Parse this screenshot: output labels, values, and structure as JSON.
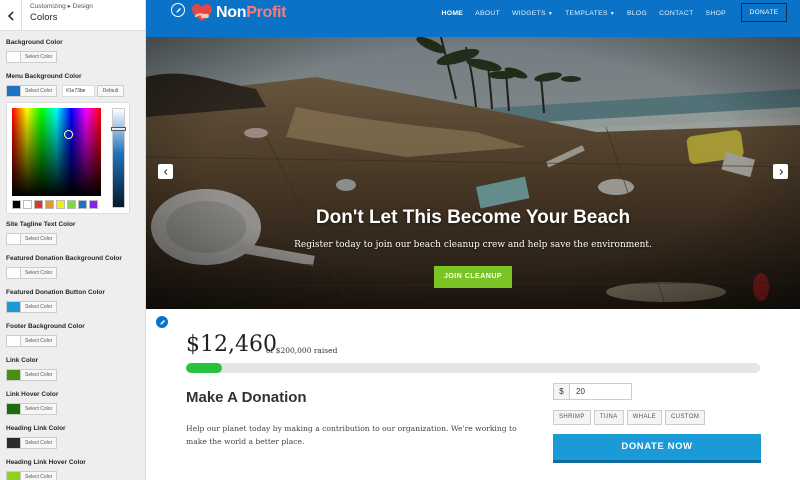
{
  "sidebar": {
    "breadcrumb": "Customizing ▸ Design",
    "title": "Colors",
    "fields": [
      {
        "label": "Background Color",
        "button": "Select Color",
        "color": "#ffffff"
      },
      {
        "label": "Menu Background Color",
        "button": "Select Color",
        "color": "#1e73be",
        "hex_value": "#1e73be",
        "default_label": "Default"
      },
      {
        "label": "Site Tagline Text Color",
        "button": "Select Color",
        "color": "#ffffff"
      },
      {
        "label": "Featured Donation Background Color",
        "button": "Select Color",
        "color": "#ffffff"
      },
      {
        "label": "Featured Donation Button Color",
        "button": "Select Color",
        "color": "#1a9ad6"
      },
      {
        "label": "Footer Background Color",
        "button": "Select Color",
        "color": "#ffffff"
      },
      {
        "label": "Link Color",
        "button": "Select Color",
        "color": "#4a8f12"
      },
      {
        "label": "Link Hover Color",
        "button": "Select Color",
        "color": "#1e6b0e"
      },
      {
        "label": "Heading Link Color",
        "button": "Select Color",
        "color": "#2a2a2a"
      },
      {
        "label": "Heading Link Hover Color",
        "button": "Select Color",
        "color": "#8ed21d"
      }
    ],
    "palette": [
      "#000000",
      "#ffffff",
      "#dd3333",
      "#dd9933",
      "#eeee22",
      "#81d742",
      "#1e73be",
      "#8224e3"
    ]
  },
  "site": {
    "logo_part1": "Non",
    "logo_part2": "Profit",
    "nav": [
      {
        "label": "HOME",
        "active": true,
        "dropdown": false
      },
      {
        "label": "ABOUT",
        "active": false,
        "dropdown": false
      },
      {
        "label": "WIDGETS",
        "active": false,
        "dropdown": true
      },
      {
        "label": "TEMPLATES",
        "active": false,
        "dropdown": true
      },
      {
        "label": "BLOG",
        "active": false,
        "dropdown": false
      },
      {
        "label": "CONTACT",
        "active": false,
        "dropdown": false
      },
      {
        "label": "SHOP",
        "active": false,
        "dropdown": false
      }
    ],
    "donate_label": "DONATE",
    "accent": "#0a73c7"
  },
  "hero": {
    "title": "Don't Let This Become Your Beach",
    "subtitle": "Register today to join our beach cleanup crew and help save the environment.",
    "cta": "JOIN CLEANUP"
  },
  "campaign": {
    "raised": "$12,460",
    "goal_text": "of $200,000 raised",
    "progress_fraction": 0.0623
  },
  "donation": {
    "title": "Make A Donation",
    "text": "Help our planet today by making a contribution to our organization. We're working to make the world a better place.",
    "currency": "$",
    "amount": "20",
    "presets": [
      "SHRIMP",
      "TUNA",
      "WHALE",
      "CUSTOM"
    ],
    "button": "DONATE NOW"
  }
}
